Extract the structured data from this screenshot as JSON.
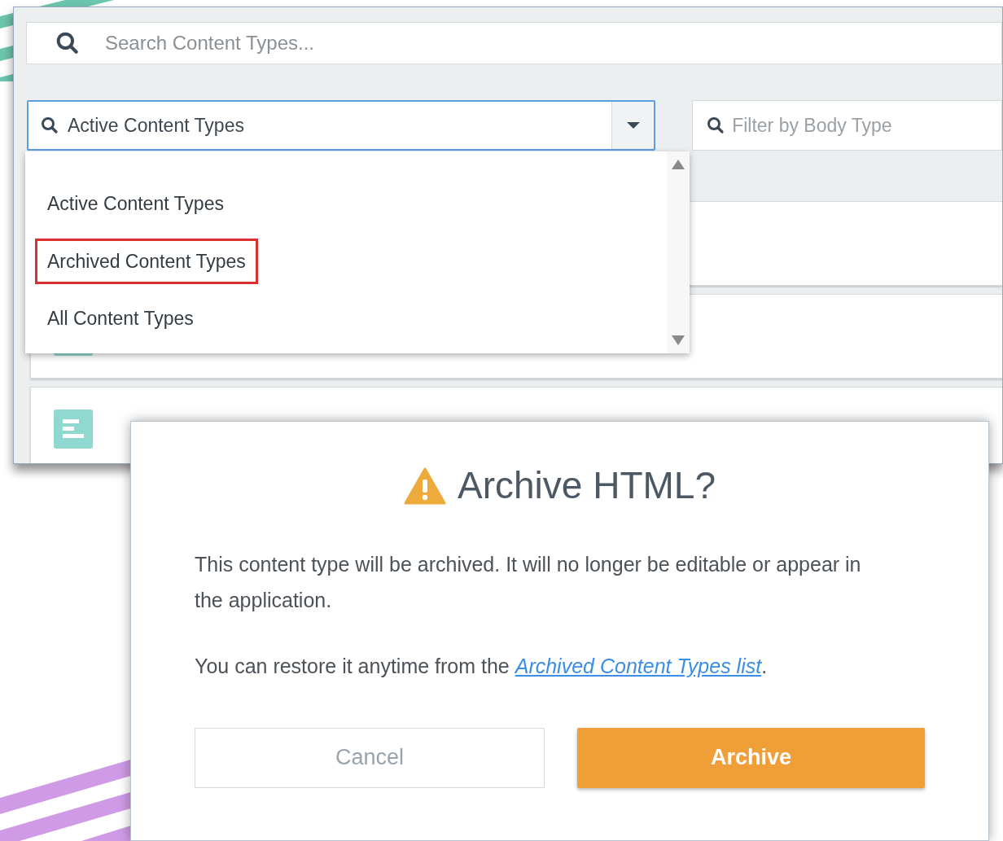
{
  "search": {
    "placeholder": "Search Content Types..."
  },
  "status_filter": {
    "value": "Active Content Types",
    "expanded": true,
    "options": [
      {
        "label": "Active Content Types",
        "highlighted": false
      },
      {
        "label": "Archived Content Types",
        "highlighted": true
      },
      {
        "label": "All Content Types",
        "highlighted": false
      }
    ]
  },
  "body_filter": {
    "placeholder": "Filter by Body Type"
  },
  "dialog": {
    "title": "Archive HTML?",
    "message": "This content type will be archived. It will no longer be editable or appear in the application.",
    "note": {
      "text": "You can restore it anytime from the ",
      "link": "Archived Content Types list",
      "after": "."
    },
    "buttons": [
      {
        "label": "Cancel",
        "kind": "secondary"
      },
      {
        "label": "Archive",
        "kind": "primary"
      }
    ]
  }
}
